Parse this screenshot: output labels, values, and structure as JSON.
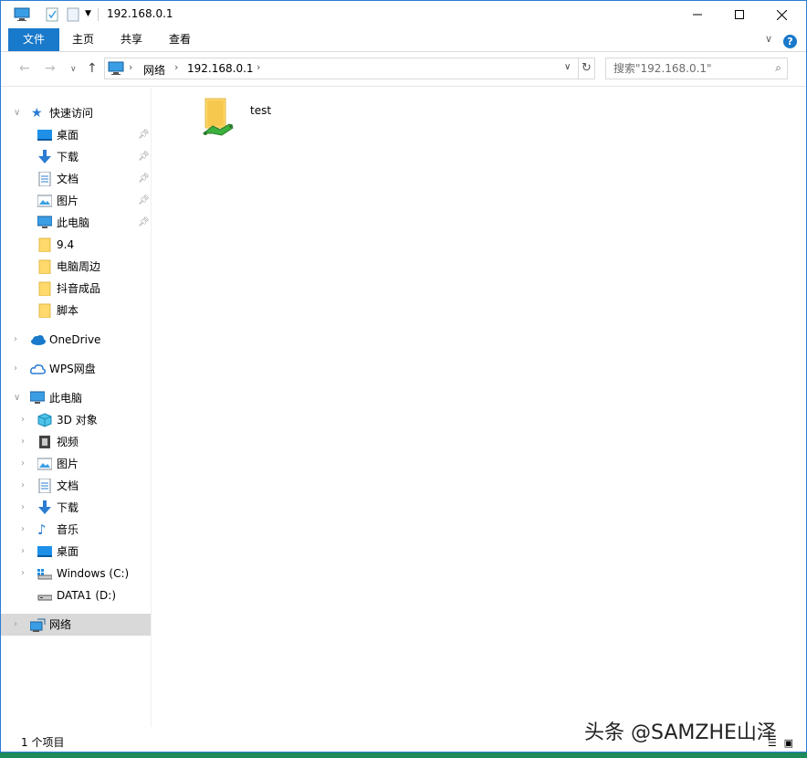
{
  "window": {
    "title": "192.168.0.1"
  },
  "ribbon": {
    "tabs": [
      {
        "label": "文件"
      },
      {
        "label": "主页"
      },
      {
        "label": "共享"
      },
      {
        "label": "查看"
      }
    ]
  },
  "navbar": {
    "breadcrumb": [
      {
        "label": "网络"
      },
      {
        "label": "192.168.0.1"
      }
    ],
    "search_placeholder": "搜索\"192.168.0.1\""
  },
  "sidebar": {
    "quick_access": {
      "label": "快速访问"
    },
    "quick_items": [
      {
        "label": "桌面",
        "icon": "desktop-icon",
        "pinned": true
      },
      {
        "label": "下载",
        "icon": "download-icon",
        "pinned": true
      },
      {
        "label": "文档",
        "icon": "document-icon",
        "pinned": true
      },
      {
        "label": "图片",
        "icon": "pictures-icon",
        "pinned": true
      },
      {
        "label": "此电脑",
        "icon": "computer-icon",
        "pinned": true
      },
      {
        "label": "9.4",
        "icon": "folder-icon",
        "pinned": false
      },
      {
        "label": "电脑周边",
        "icon": "folder-icon",
        "pinned": false
      },
      {
        "label": "抖音成品",
        "icon": "folder-icon",
        "pinned": false
      },
      {
        "label": "脚本",
        "icon": "folder-icon",
        "pinned": false
      }
    ],
    "onedrive": {
      "label": "OneDrive"
    },
    "wps": {
      "label": "WPS网盘"
    },
    "this_pc": {
      "label": "此电脑"
    },
    "pc_items": [
      {
        "label": "3D 对象",
        "icon": "3d-objects-icon"
      },
      {
        "label": "视频",
        "icon": "video-icon"
      },
      {
        "label": "图片",
        "icon": "pictures-icon"
      },
      {
        "label": "文档",
        "icon": "document-icon"
      },
      {
        "label": "下载",
        "icon": "download-icon"
      },
      {
        "label": "音乐",
        "icon": "music-icon"
      },
      {
        "label": "桌面",
        "icon": "desktop-icon"
      },
      {
        "label": "Windows (C:)",
        "icon": "windows-drive-icon"
      },
      {
        "label": "DATA1 (D:)",
        "icon": "drive-icon"
      }
    ],
    "network": {
      "label": "网络"
    }
  },
  "content": {
    "items": [
      {
        "label": "test",
        "icon": "shared-folder-icon"
      }
    ]
  },
  "status": {
    "text": "1 个项目"
  },
  "watermark": "头条 @SAMZHE山泽"
}
